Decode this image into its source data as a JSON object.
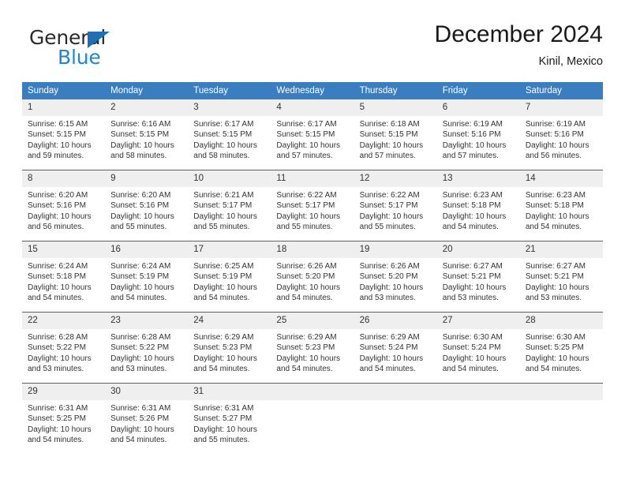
{
  "brand": {
    "line1": "General",
    "line2": "Blue",
    "triangle_color": "#1f6fb2",
    "blue_text_color": "#1d86d6"
  },
  "header": {
    "title": "December 2024",
    "subtitle": "Kinil, Mexico"
  },
  "theme": {
    "header_row_bg": "#3a7ebf",
    "day_number_bg": "#efefef",
    "week_separator": "#2b6cab",
    "text": "#333333"
  },
  "weekday_headers": [
    "Sunday",
    "Monday",
    "Tuesday",
    "Wednesday",
    "Thursday",
    "Friday",
    "Saturday"
  ],
  "weeks": [
    [
      {
        "day": "1",
        "sunrise": "Sunrise: 6:15 AM",
        "sunset": "Sunset: 5:15 PM",
        "daylight1": "Daylight: 10 hours",
        "daylight2": "and 59 minutes."
      },
      {
        "day": "2",
        "sunrise": "Sunrise: 6:16 AM",
        "sunset": "Sunset: 5:15 PM",
        "daylight1": "Daylight: 10 hours",
        "daylight2": "and 58 minutes."
      },
      {
        "day": "3",
        "sunrise": "Sunrise: 6:17 AM",
        "sunset": "Sunset: 5:15 PM",
        "daylight1": "Daylight: 10 hours",
        "daylight2": "and 58 minutes."
      },
      {
        "day": "4",
        "sunrise": "Sunrise: 6:17 AM",
        "sunset": "Sunset: 5:15 PM",
        "daylight1": "Daylight: 10 hours",
        "daylight2": "and 57 minutes."
      },
      {
        "day": "5",
        "sunrise": "Sunrise: 6:18 AM",
        "sunset": "Sunset: 5:15 PM",
        "daylight1": "Daylight: 10 hours",
        "daylight2": "and 57 minutes."
      },
      {
        "day": "6",
        "sunrise": "Sunrise: 6:19 AM",
        "sunset": "Sunset: 5:16 PM",
        "daylight1": "Daylight: 10 hours",
        "daylight2": "and 57 minutes."
      },
      {
        "day": "7",
        "sunrise": "Sunrise: 6:19 AM",
        "sunset": "Sunset: 5:16 PM",
        "daylight1": "Daylight: 10 hours",
        "daylight2": "and 56 minutes."
      }
    ],
    [
      {
        "day": "8",
        "sunrise": "Sunrise: 6:20 AM",
        "sunset": "Sunset: 5:16 PM",
        "daylight1": "Daylight: 10 hours",
        "daylight2": "and 56 minutes."
      },
      {
        "day": "9",
        "sunrise": "Sunrise: 6:20 AM",
        "sunset": "Sunset: 5:16 PM",
        "daylight1": "Daylight: 10 hours",
        "daylight2": "and 55 minutes."
      },
      {
        "day": "10",
        "sunrise": "Sunrise: 6:21 AM",
        "sunset": "Sunset: 5:17 PM",
        "daylight1": "Daylight: 10 hours",
        "daylight2": "and 55 minutes."
      },
      {
        "day": "11",
        "sunrise": "Sunrise: 6:22 AM",
        "sunset": "Sunset: 5:17 PM",
        "daylight1": "Daylight: 10 hours",
        "daylight2": "and 55 minutes."
      },
      {
        "day": "12",
        "sunrise": "Sunrise: 6:22 AM",
        "sunset": "Sunset: 5:17 PM",
        "daylight1": "Daylight: 10 hours",
        "daylight2": "and 55 minutes."
      },
      {
        "day": "13",
        "sunrise": "Sunrise: 6:23 AM",
        "sunset": "Sunset: 5:18 PM",
        "daylight1": "Daylight: 10 hours",
        "daylight2": "and 54 minutes."
      },
      {
        "day": "14",
        "sunrise": "Sunrise: 6:23 AM",
        "sunset": "Sunset: 5:18 PM",
        "daylight1": "Daylight: 10 hours",
        "daylight2": "and 54 minutes."
      }
    ],
    [
      {
        "day": "15",
        "sunrise": "Sunrise: 6:24 AM",
        "sunset": "Sunset: 5:18 PM",
        "daylight1": "Daylight: 10 hours",
        "daylight2": "and 54 minutes."
      },
      {
        "day": "16",
        "sunrise": "Sunrise: 6:24 AM",
        "sunset": "Sunset: 5:19 PM",
        "daylight1": "Daylight: 10 hours",
        "daylight2": "and 54 minutes."
      },
      {
        "day": "17",
        "sunrise": "Sunrise: 6:25 AM",
        "sunset": "Sunset: 5:19 PM",
        "daylight1": "Daylight: 10 hours",
        "daylight2": "and 54 minutes."
      },
      {
        "day": "18",
        "sunrise": "Sunrise: 6:26 AM",
        "sunset": "Sunset: 5:20 PM",
        "daylight1": "Daylight: 10 hours",
        "daylight2": "and 54 minutes."
      },
      {
        "day": "19",
        "sunrise": "Sunrise: 6:26 AM",
        "sunset": "Sunset: 5:20 PM",
        "daylight1": "Daylight: 10 hours",
        "daylight2": "and 53 minutes."
      },
      {
        "day": "20",
        "sunrise": "Sunrise: 6:27 AM",
        "sunset": "Sunset: 5:21 PM",
        "daylight1": "Daylight: 10 hours",
        "daylight2": "and 53 minutes."
      },
      {
        "day": "21",
        "sunrise": "Sunrise: 6:27 AM",
        "sunset": "Sunset: 5:21 PM",
        "daylight1": "Daylight: 10 hours",
        "daylight2": "and 53 minutes."
      }
    ],
    [
      {
        "day": "22",
        "sunrise": "Sunrise: 6:28 AM",
        "sunset": "Sunset: 5:22 PM",
        "daylight1": "Daylight: 10 hours",
        "daylight2": "and 53 minutes."
      },
      {
        "day": "23",
        "sunrise": "Sunrise: 6:28 AM",
        "sunset": "Sunset: 5:22 PM",
        "daylight1": "Daylight: 10 hours",
        "daylight2": "and 53 minutes."
      },
      {
        "day": "24",
        "sunrise": "Sunrise: 6:29 AM",
        "sunset": "Sunset: 5:23 PM",
        "daylight1": "Daylight: 10 hours",
        "daylight2": "and 54 minutes."
      },
      {
        "day": "25",
        "sunrise": "Sunrise: 6:29 AM",
        "sunset": "Sunset: 5:23 PM",
        "daylight1": "Daylight: 10 hours",
        "daylight2": "and 54 minutes."
      },
      {
        "day": "26",
        "sunrise": "Sunrise: 6:29 AM",
        "sunset": "Sunset: 5:24 PM",
        "daylight1": "Daylight: 10 hours",
        "daylight2": "and 54 minutes."
      },
      {
        "day": "27",
        "sunrise": "Sunrise: 6:30 AM",
        "sunset": "Sunset: 5:24 PM",
        "daylight1": "Daylight: 10 hours",
        "daylight2": "and 54 minutes."
      },
      {
        "day": "28",
        "sunrise": "Sunrise: 6:30 AM",
        "sunset": "Sunset: 5:25 PM",
        "daylight1": "Daylight: 10 hours",
        "daylight2": "and 54 minutes."
      }
    ],
    [
      {
        "day": "29",
        "sunrise": "Sunrise: 6:31 AM",
        "sunset": "Sunset: 5:25 PM",
        "daylight1": "Daylight: 10 hours",
        "daylight2": "and 54 minutes."
      },
      {
        "day": "30",
        "sunrise": "Sunrise: 6:31 AM",
        "sunset": "Sunset: 5:26 PM",
        "daylight1": "Daylight: 10 hours",
        "daylight2": "and 54 minutes."
      },
      {
        "day": "31",
        "sunrise": "Sunrise: 6:31 AM",
        "sunset": "Sunset: 5:27 PM",
        "daylight1": "Daylight: 10 hours",
        "daylight2": "and 55 minutes."
      },
      {
        "day": "",
        "sunrise": "",
        "sunset": "",
        "daylight1": "",
        "daylight2": ""
      },
      {
        "day": "",
        "sunrise": "",
        "sunset": "",
        "daylight1": "",
        "daylight2": ""
      },
      {
        "day": "",
        "sunrise": "",
        "sunset": "",
        "daylight1": "",
        "daylight2": ""
      },
      {
        "day": "",
        "sunrise": "",
        "sunset": "",
        "daylight1": "",
        "daylight2": ""
      }
    ]
  ]
}
